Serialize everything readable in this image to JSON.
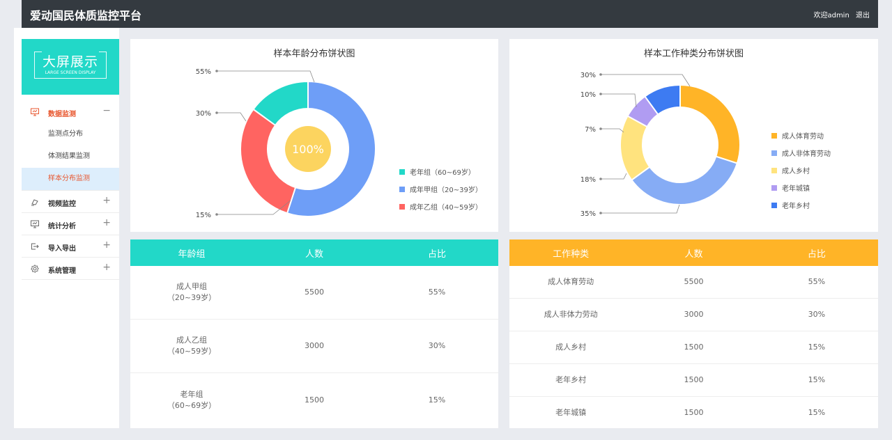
{
  "header": {
    "title": "爱动国民体质监控平台",
    "welcome": "欢迎admin",
    "logout": "退出"
  },
  "sidebar": {
    "big_screen": {
      "title": "大屏展示",
      "subtitle": "LARGE SCREEN DISPLAY"
    },
    "menu": [
      {
        "label": "数据监测",
        "icon": "monitor-icon",
        "toggle": "−",
        "sub": [
          "监测点分布",
          "体测结果监测",
          "样本分布监测"
        ]
      },
      {
        "label": "视频监控",
        "icon": "camera-icon",
        "toggle": "+"
      },
      {
        "label": "统计分析",
        "icon": "chart-screen-icon",
        "toggle": "+"
      },
      {
        "label": "导入导出",
        "icon": "export-icon",
        "toggle": "+"
      },
      {
        "label": "系统管理",
        "icon": "gear-icon",
        "toggle": "+"
      }
    ]
  },
  "chart_data": [
    {
      "type": "pie",
      "title": "样本年龄分布饼状图",
      "center_label": "100%",
      "series": [
        {
          "name": "老年组（60~69岁）",
          "value": 15,
          "color": "#22d8c8"
        },
        {
          "name": "成年甲组（20~39岁）",
          "value": 55,
          "color": "#6e9ef7"
        },
        {
          "name": "成年乙组（40~59岁）",
          "value": 30,
          "color": "#ff6461"
        }
      ],
      "slice_labels": [
        "55%",
        "30%",
        "15%"
      ],
      "legend_position": "right"
    },
    {
      "type": "pie",
      "title": "样本工作种类分布饼状图",
      "series": [
        {
          "name": "成人体育劳动",
          "value": 30,
          "color": "#ffb427"
        },
        {
          "name": "成人非体育劳动",
          "value": 35,
          "color": "#86acf5"
        },
        {
          "name": "成人乡村",
          "value": 18,
          "color": "#ffe37e"
        },
        {
          "name": "老年城镇",
          "value": 7,
          "color": "#b09cf2"
        },
        {
          "name": "老年乡村",
          "value": 10,
          "color": "#3d7bf2"
        }
      ],
      "slice_labels": [
        "30%",
        "10%",
        "7%",
        "18%",
        "35%"
      ],
      "legend_position": "right"
    }
  ],
  "age_table": {
    "headers": [
      "年龄组",
      "人数",
      "占比"
    ],
    "rows": [
      {
        "group": "成人甲组",
        "range": "（20~39岁）",
        "count": "5500",
        "ratio": "55%"
      },
      {
        "group": "成人乙组",
        "range": "（40~59岁）",
        "count": "3000",
        "ratio": "30%"
      },
      {
        "group": "老年组",
        "range": "（60~69岁）",
        "count": "1500",
        "ratio": "15%"
      }
    ]
  },
  "work_table": {
    "headers": [
      "工作种类",
      "人数",
      "占比"
    ],
    "rows": [
      {
        "type": "成人体育劳动",
        "count": "5500",
        "ratio": "55%"
      },
      {
        "type": "成人非体力劳动",
        "count": "3000",
        "ratio": "30%"
      },
      {
        "type": "成人乡村",
        "count": "1500",
        "ratio": "15%"
      },
      {
        "type": "老年乡村",
        "count": "1500",
        "ratio": "15%"
      },
      {
        "type": "老年城镇",
        "count": "1500",
        "ratio": "15%"
      }
    ]
  },
  "colors": {
    "teal": "#22d8c8",
    "orange": "#ffb427",
    "topbar": "#343a40",
    "active_text": "#e8572f"
  }
}
